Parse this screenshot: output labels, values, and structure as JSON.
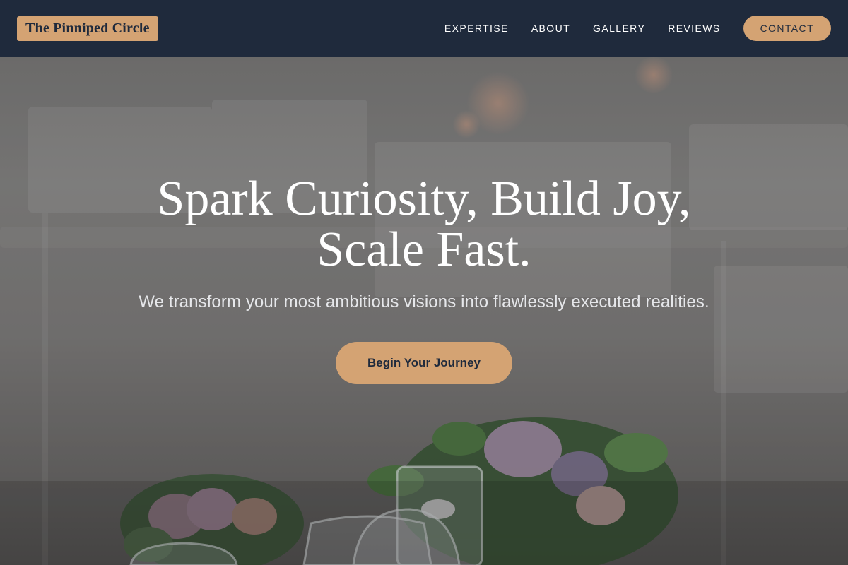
{
  "nav": {
    "logo": "The Pinniped Circle",
    "links": [
      "EXPERTISE",
      "ABOUT",
      "GALLERY",
      "REVIEWS"
    ],
    "cta_label": "CONTACT"
  },
  "hero": {
    "title": "Spark Curiosity, Build Joy, Scale Fast.",
    "subtitle": "We transform your most ambitious visions into flawlessly executed realities.",
    "cta_label": "Begin Your Journey"
  },
  "colors": {
    "nav_background": "#1f2a3c",
    "accent": "#d4a373",
    "text_light": "#ffffff"
  }
}
